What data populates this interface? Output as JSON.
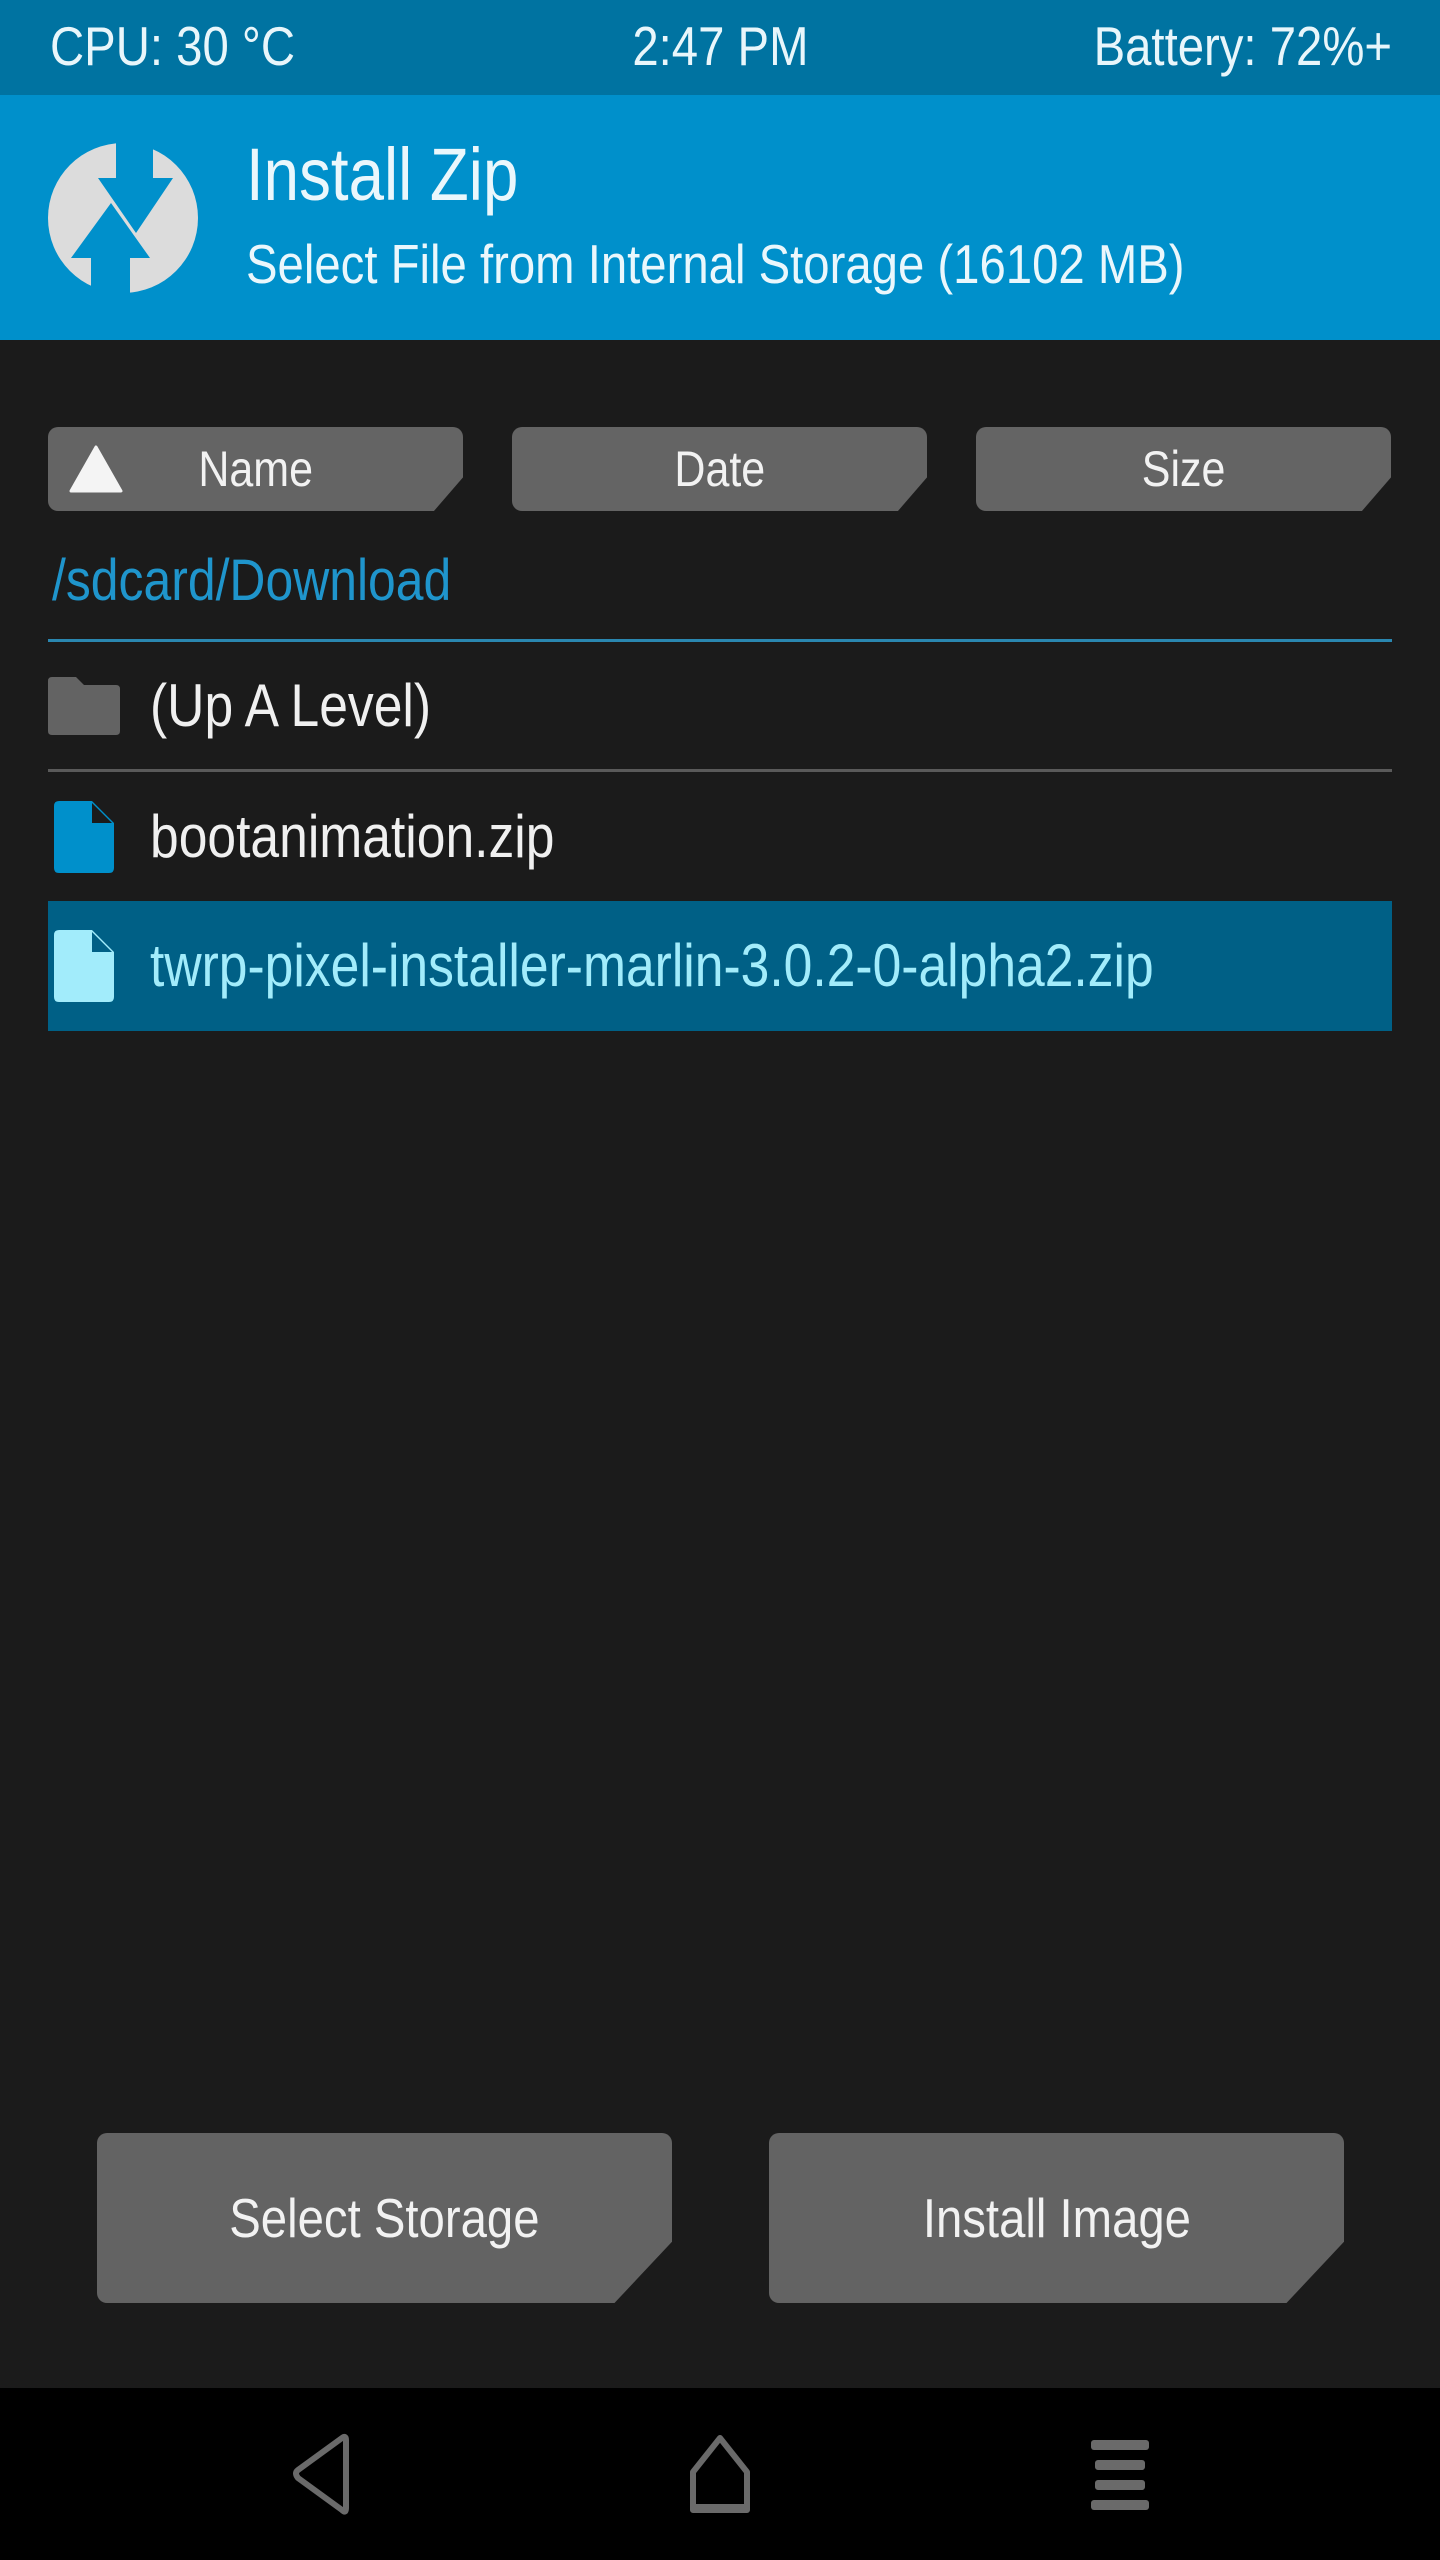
{
  "status_bar": {
    "cpu": "CPU: 30 °C",
    "time": "2:47 PM",
    "battery": "Battery: 72%+"
  },
  "header": {
    "logo_icon": "twrp-logo-icon",
    "title": "Install Zip",
    "subtitle": "Select File from Internal Storage (16102 MB)"
  },
  "sort": {
    "buttons": [
      {
        "label": "Name",
        "active": true,
        "direction": "ascending"
      },
      {
        "label": "Date",
        "active": false
      },
      {
        "label": "Size",
        "active": false
      }
    ]
  },
  "browser": {
    "current_path": "/sdcard/Download",
    "items": [
      {
        "name": "(Up A Level)",
        "type": "folder",
        "icon": "folder-icon",
        "selected": false
      },
      {
        "name": "bootanimation.zip",
        "type": "file",
        "icon": "file-icon",
        "selected": false
      },
      {
        "name": "twrp-pixel-installer-marlin-3.0.2-0-alpha2.zip",
        "type": "file",
        "icon": "file-icon",
        "selected": true
      }
    ]
  },
  "actions": {
    "select_storage": "Select Storage",
    "install_image": "Install Image"
  },
  "nav": {
    "back_icon": "back-icon",
    "home_icon": "home-icon",
    "menu_icon": "menu-icon"
  },
  "colors": {
    "status_bar": "#0073a1",
    "header": "#0090cb",
    "accent": "#1f95cc",
    "selected_row": "#006086",
    "selected_text": "#a2ecfb",
    "button": "#646464",
    "background": "#1b1b1b"
  }
}
